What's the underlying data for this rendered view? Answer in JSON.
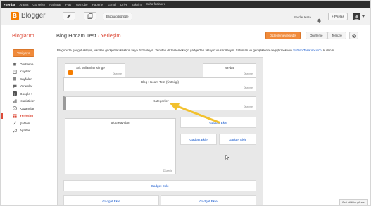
{
  "google_bar": {
    "items": [
      "+Serdar",
      "Arama",
      "Görseller",
      "Haritalar",
      "Play",
      "YouTube",
      "Haberler",
      "Gmail",
      "Drive",
      "Takvim",
      "Daha fazlası ▾"
    ]
  },
  "header": {
    "logo_text": "Blogger",
    "view_blog_label": "Blog'u görüntüle",
    "user_name": "Serdar Kara",
    "share_label": "+ Paylaş"
  },
  "subheader": {
    "blogs_link": "Bloglarım",
    "blog_name": "Blog Hocam Test",
    "separator": "·",
    "section": "Yerleşim",
    "save_label": "Düzenlemeyi kaydet",
    "preview_label": "Önizleme",
    "clear_label": "Temizle"
  },
  "sidebar": {
    "new_post_label": "Yeni yayın",
    "items": [
      {
        "label": "Önizleme",
        "icon": "home-icon"
      },
      {
        "label": "Kayıtlar",
        "icon": "posts-icon"
      },
      {
        "label": "Sayfalar",
        "icon": "pages-icon"
      },
      {
        "label": "Yorumlar",
        "icon": "comments-icon"
      },
      {
        "label": "Google+",
        "icon": "google-plus-icon"
      },
      {
        "label": "İstatistikler",
        "icon": "stats-icon"
      },
      {
        "label": "Kazançlar",
        "icon": "earnings-icon"
      },
      {
        "label": "Yerleşim",
        "icon": "layout-icon"
      },
      {
        "label": "Şablon",
        "icon": "template-icon"
      },
      {
        "label": "Ayarlar",
        "icon": "settings-icon"
      }
    ],
    "active_index": 7
  },
  "main": {
    "intro": "Blogunuza gadget ekleyin, varolan gadget'ları kaldırın veya düzenleyin. Yeniden düzenlemek için gadget'ları tıklayın ve sürükleyin. Sütunları ve genişliklerini değiştirmek için",
    "intro_link": "Şablon Tasarımcısı'nı",
    "intro_end": "kullanın.",
    "gadgets": {
      "search": {
        "title": "Sık kullanılan simge",
        "edit": "Düzenle"
      },
      "navbar": {
        "title": "Navbar",
        "edit": "Düzenle"
      },
      "header": {
        "title": "Blog Hocam Test (Üstbilgi)",
        "edit": "Düzenle"
      },
      "categories": {
        "title": "Kategoriler",
        "edit": "Düzenle"
      },
      "posts": {
        "title": "Blog Kayıtları",
        "edit": "Düzenle"
      }
    },
    "add_gadget_label": "Gadget Ekle"
  },
  "feedback_label": "Geri bildirim gönder",
  "colors": {
    "accent": "#dd4b39",
    "brand": "#f57d00",
    "arrow": "#f2c12e",
    "link": "#1155cc"
  }
}
